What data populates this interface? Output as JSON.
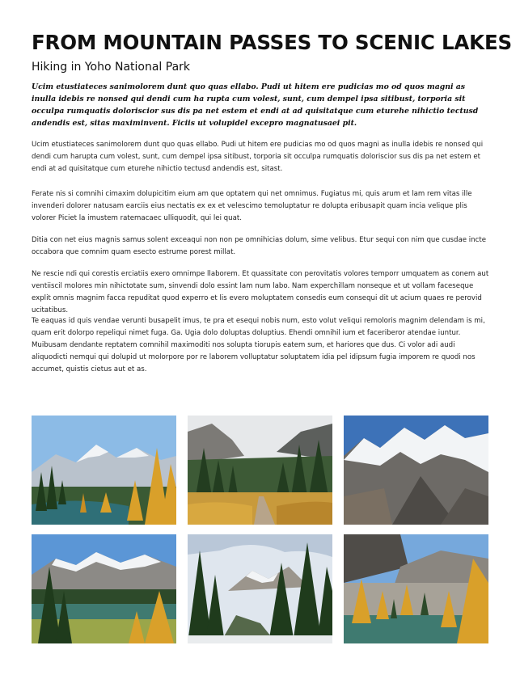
{
  "title": "FROM MOUNTAIN PASSES TO SCENIC LAKES",
  "subtitle": "Hiking in Yoho National Park",
  "lead": "Ucim etustiateces sanimolorem dunt quo quas ellabo. Pudi ut hitem ere pudicias mo od quos magni as inulla idebis re nonsed qui dendi cum ha rupta cum volest, sunt, cum dempel ipsa sitibust, torporia sit occulpa rumquatis doloriscior sus dis pa net estem et endi at ad quisitatque cum eturehe nihictio tectusd andendis est, sitas maximinvent. Ficiis ut volupidel excepro magnatusaei pit.",
  "paragraphs": [
    "Ucim etustiateces sanimolorem dunt quo quas ellabo. Pudi ut hitem ere pudicias mo od quos magni as inulla idebis re nonsed qui dendi cum harupta cum volest, sunt, cum dempel ipsa sitibust, torporia sit occulpa rumquatis doloriscior sus dis pa net estem et endi at ad quisitatque cum eturehe nihictio tectusd andendis est, sitast.",
    "Ferate nis si comnihi cimaxim dolupicitim eium am que optatem qui net omnimus. Fugiatus mi, quis arum et lam rem vitas ille invenderi dolorer natusam earciis eius nectatis ex ex et velescimo temoluptatur re dolupta eribusapit quam incia velique plis volorer Piciet la imustem ratemacaec ulliquodit, qui lei quat.",
    "Ditia con net eius magnis samus solent exceaqui non non pe omnihicias dolum, sime velibus. Etur sequi con nim que cusdae incte occabora que comnim quam esecto estrume porest millat.",
    "Ne rescie ndi qui corestis erciatiis exero omnimpe llaborem. Et quassitate con perovitatis volores temporr umquatem as conem aut ventiiscil molores min nihictotate sum, sinvendi dolo essint lam num labo. Nam experchillam nonseque et ut vollam faceseque explit omnis magnim facca repuditat quod experro et lis evero moluptatem consedis eum consequi dit ut acium quaes re perovid ucitatibus.",
    "Te eaquas id quis vendae verunti busapelit imus, te pra et esequi nobis num, esto volut veliqui remoloris magnim delendam is mi, quam erit dolorpo repeliqui nimet fuga. Ga. Ugia dolo doluptas doluptius. Ehendi omnihil ium et faceriberor atendae iuntur. Muibusam dendante reptatem comnihil maximoditi nos solupta tiorupis eatem sum, et hariores que dus. Ci volor adi audi aliquodicti nemqui qui dolupid ut molorpore por re laborem volluptatur soluptatem idia pel idipsum fugia imporem re quodi nos accumet, quistis cietus aut et as."
  ],
  "photos": [
    {
      "subject": "mountain-lake-autumn-larches"
    },
    {
      "subject": "forest-trail-valley"
    },
    {
      "subject": "snowy-rocky-peaks"
    },
    {
      "subject": "lake-snowcapped-range"
    },
    {
      "subject": "evergreen-forest-peak"
    },
    {
      "subject": "golden-larches-lakeshore"
    }
  ],
  "colors": {
    "sky": "#7fb0e0",
    "snow": "#f2f4f6",
    "rock": "#6d6a66",
    "forest": "#2d4a2a",
    "larch": "#d9a02a",
    "lake": "#2f6f77"
  }
}
